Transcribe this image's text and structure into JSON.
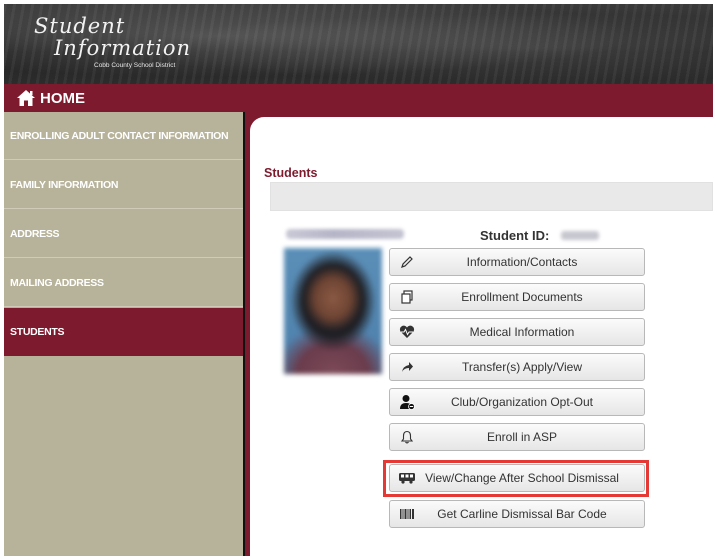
{
  "header": {
    "brand_line1": "Student",
    "brand_line2": "Information",
    "district": "Cobb County School District"
  },
  "home": {
    "label": "HOME"
  },
  "sidebar": {
    "items": [
      {
        "label": "ENROLLING ADULT CONTACT INFORMATION",
        "active": false
      },
      {
        "label": "FAMILY INFORMATION",
        "active": false
      },
      {
        "label": "ADDRESS",
        "active": false
      },
      {
        "label": "MAILING ADDRESS",
        "active": false
      },
      {
        "label": "STUDENTS",
        "active": true
      }
    ]
  },
  "students": {
    "section_title": "Students",
    "student_id_label": "Student ID:",
    "actions": [
      {
        "label": "Information/Contacts",
        "icon": "pencil-icon"
      },
      {
        "label": "Enrollment Documents",
        "icon": "documents-icon"
      },
      {
        "label": "Medical Information",
        "icon": "heart-pulse-icon"
      },
      {
        "label": "Transfer(s) Apply/View",
        "icon": "arrow-right-icon"
      },
      {
        "label": "Club/Organization Opt-Out",
        "icon": "user-minus-icon"
      },
      {
        "label": "Enroll in ASP",
        "icon": "bell-icon"
      },
      {
        "label": "View/Change After School Dismissal",
        "icon": "bus-icon"
      },
      {
        "label": "Get Carline Dismissal Bar Code",
        "icon": "barcode-icon"
      }
    ]
  },
  "colors": {
    "maroon": "#7d1a2e",
    "sidebar": "#b7b29a",
    "highlight": "#e53935"
  }
}
